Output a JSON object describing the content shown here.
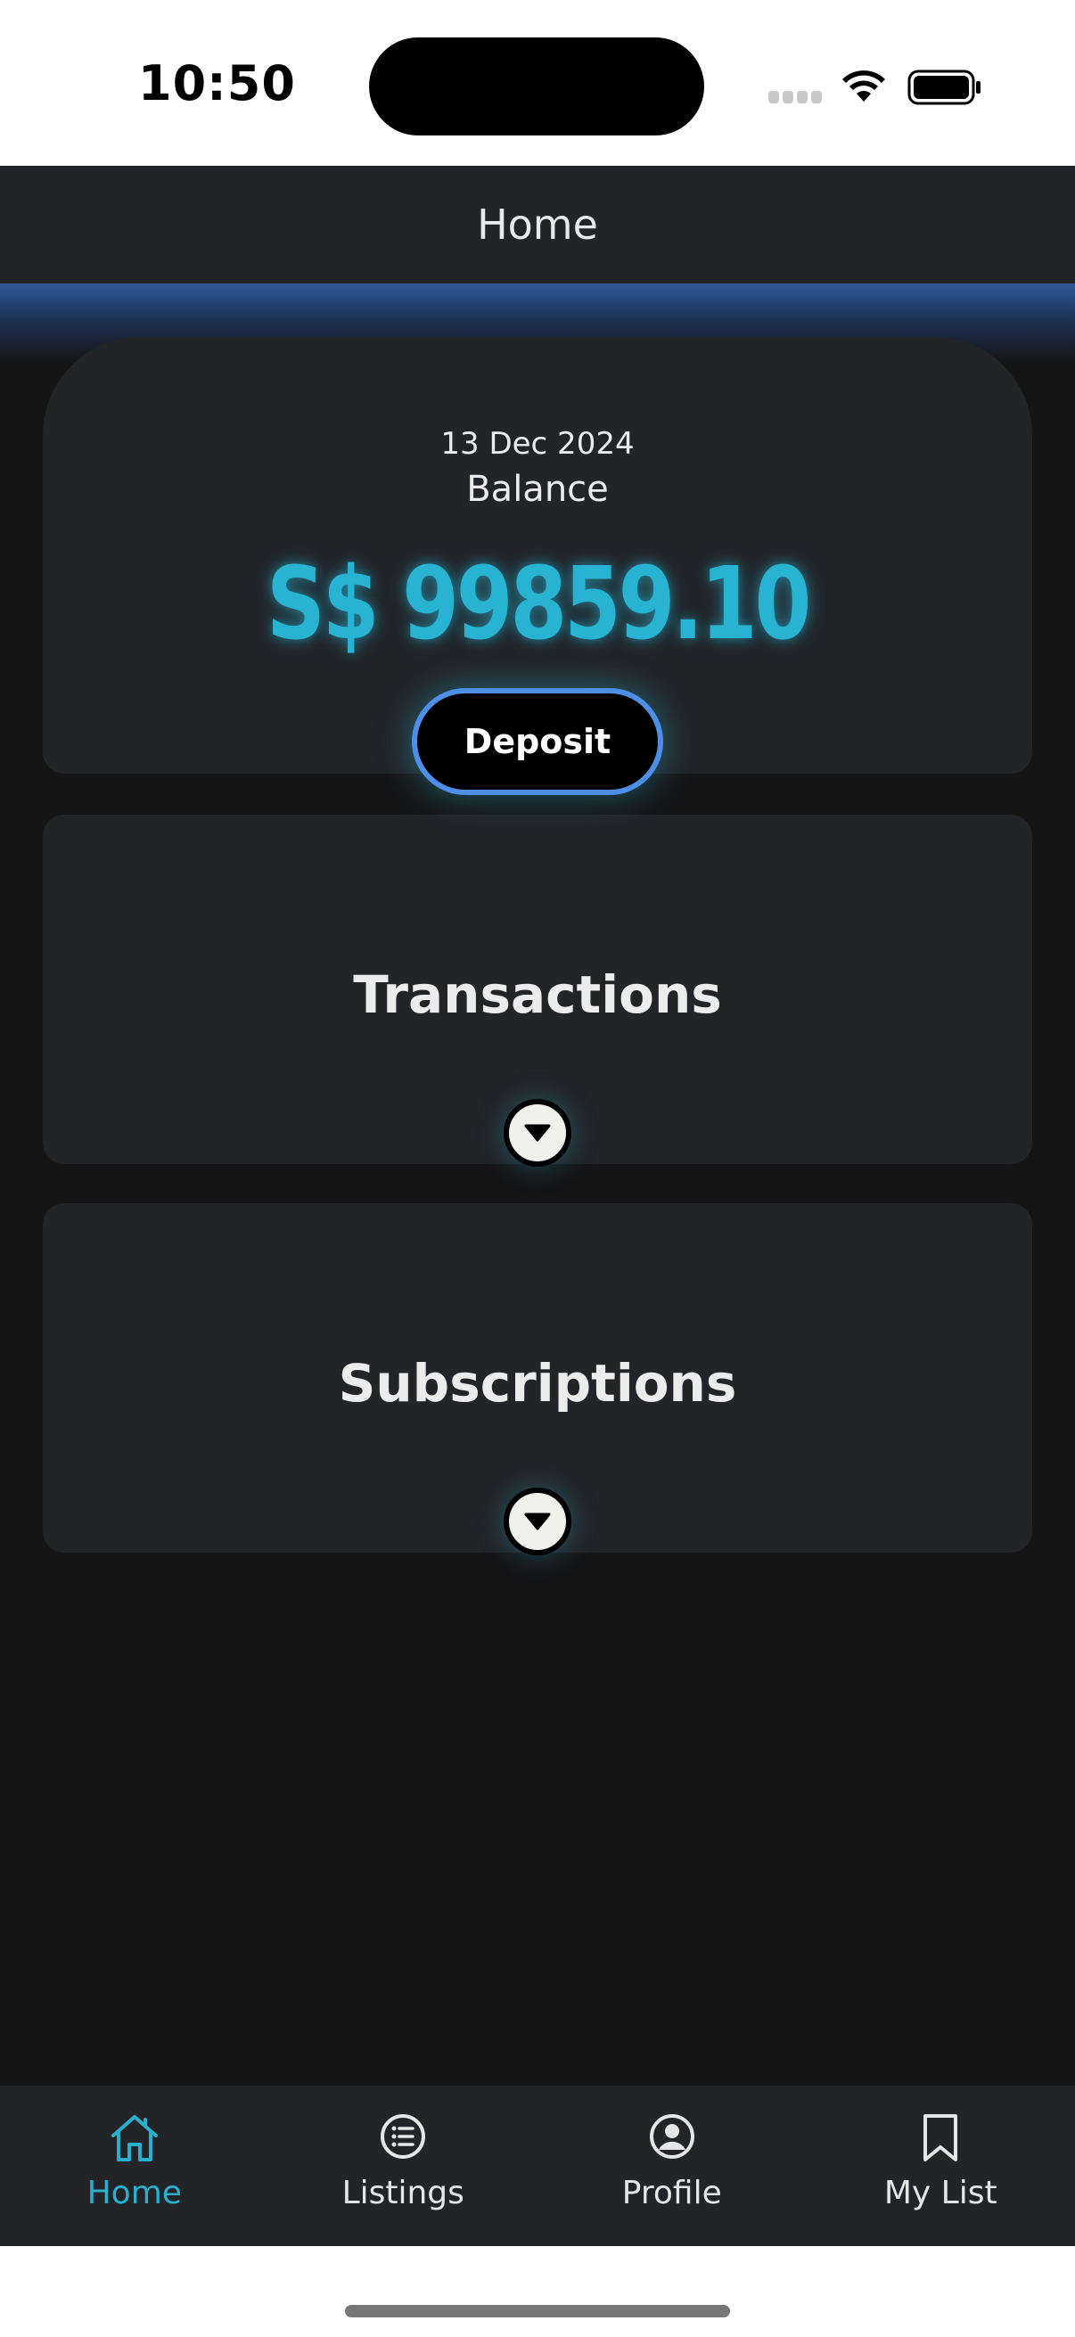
{
  "status_bar": {
    "time": "10:50"
  },
  "header": {
    "title": "Home"
  },
  "balance_card": {
    "date": "13 Dec 2024",
    "label": "Balance",
    "amount": "S$ 99859.10",
    "deposit_label": "Deposit"
  },
  "sections": {
    "transactions_title": "Transactions",
    "subscriptions_title": "Subscriptions"
  },
  "tab_bar": {
    "items": [
      {
        "label": "Home",
        "icon": "home-icon",
        "active": true
      },
      {
        "label": "Listings",
        "icon": "list-icon",
        "active": false
      },
      {
        "label": "Profile",
        "icon": "profile-icon",
        "active": false
      },
      {
        "label": "My List",
        "icon": "bookmark-icon",
        "active": false
      }
    ]
  },
  "colors": {
    "accent": "#28b3d3",
    "background": "#151516",
    "card": "#222428",
    "deposit_border": "#4d8fe6"
  }
}
